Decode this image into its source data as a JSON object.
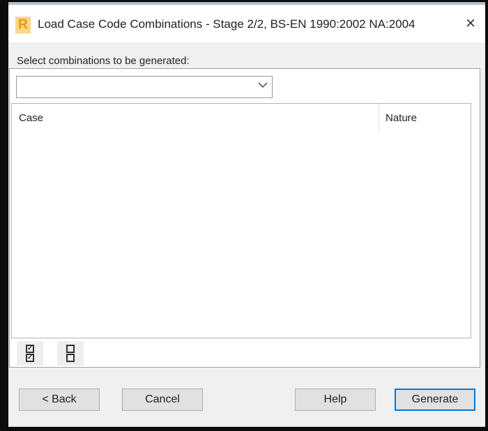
{
  "window": {
    "title": "Load Case Code Combinations - Stage 2/2, BS-EN 1990:2002 NA:2004",
    "logo": "R",
    "close_icon": "×"
  },
  "form": {
    "label": "Select combinations to be generated:",
    "combo_value": "",
    "chevron": "⌵"
  },
  "table": {
    "columns": [
      "Case",
      "Nature"
    ],
    "rows": []
  },
  "toolbar": {
    "check_all": "☑",
    "uncheck_all": "☐"
  },
  "buttons": {
    "back": "< Back",
    "cancel": "Cancel",
    "help": "Help",
    "generate": "Generate"
  },
  "colors": {
    "default_button_border": "#0078d7"
  }
}
